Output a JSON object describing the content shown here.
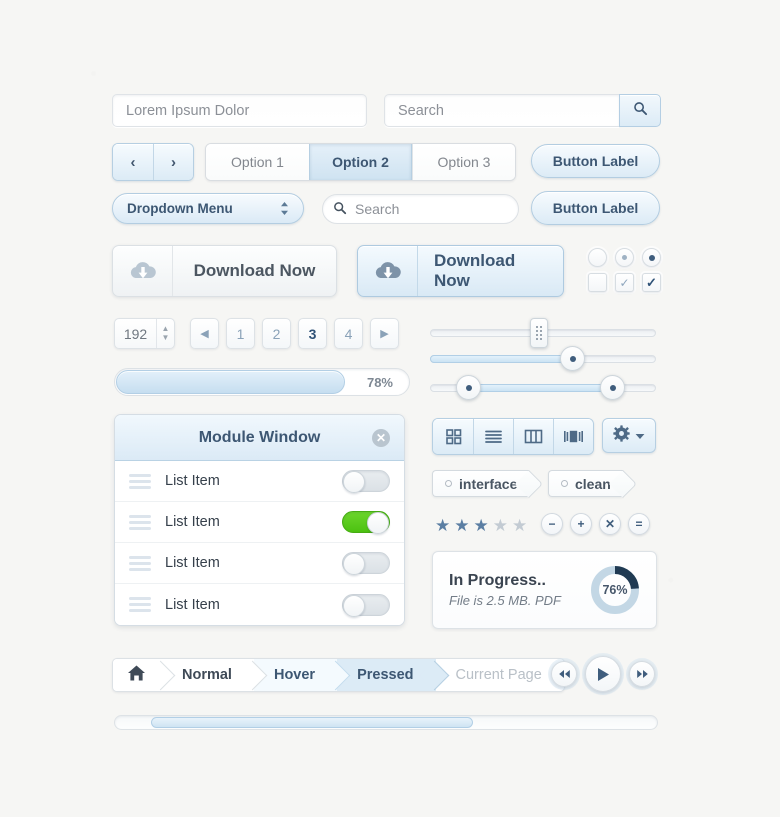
{
  "inputs": {
    "text_field_value": "Lorem Ipsum Dolor",
    "search_field_value": "Search",
    "search_button_icon": "search-icon"
  },
  "nav_arrows": {
    "prev": "‹",
    "next": "›"
  },
  "segmented": {
    "options": [
      {
        "label": "Option 1",
        "active": false
      },
      {
        "label": "Option 2",
        "active": true
      },
      {
        "label": "Option 3",
        "active": false
      }
    ]
  },
  "buttons": {
    "label_1": "Button Label",
    "label_2": "Button Label"
  },
  "dropdown": {
    "label": "Dropdown Menu",
    "icon": "updown-chevron-icon"
  },
  "search_pill": {
    "value": "Search",
    "icon": "search-icon"
  },
  "download": {
    "grey_label": "Download Now",
    "blue_label": "Download Now",
    "icon": "cloud-download-icon"
  },
  "radio_checkbox": {
    "radios": [
      "empty",
      "light-dot",
      "dark-dot"
    ],
    "checkboxes": [
      "empty",
      "light-check",
      "dark-check"
    ]
  },
  "stepper": {
    "value": "192"
  },
  "pagination": {
    "prev_icon": "◀",
    "next_icon": "▶",
    "pages": [
      "1",
      "2",
      "3",
      "4"
    ],
    "current": "3"
  },
  "progress_bar": {
    "percent_label": "78%",
    "value": 78
  },
  "sliders": [
    {
      "name": "plain-slider",
      "fill": 0,
      "handle": "square-grip",
      "position": 48
    },
    {
      "name": "single-handle-slider",
      "fill": 68,
      "handle": "round-dot",
      "position": 68
    },
    {
      "name": "range-slider",
      "from": 13,
      "to": 76
    }
  ],
  "module_window": {
    "title": "Module Window",
    "close_icon": "close-circle-icon",
    "items": [
      {
        "label": "List Item",
        "toggle_on": false
      },
      {
        "label": "List Item",
        "toggle_on": true
      },
      {
        "label": "List Item",
        "toggle_on": false
      },
      {
        "label": "List Item",
        "toggle_on": false
      }
    ]
  },
  "view_modes": {
    "icons": [
      "grid-view-icon",
      "list-view-icon",
      "column-view-icon",
      "coverflow-view-icon"
    ],
    "gear": {
      "icon": "gear-icon",
      "caret": "caret-down-icon"
    }
  },
  "tags": [
    {
      "label": "interface"
    },
    {
      "label": "clean"
    }
  ],
  "rating": {
    "filled": 3,
    "total": 5,
    "star_glyph": "★"
  },
  "circle_actions": [
    {
      "name": "minus-button",
      "glyph": "−"
    },
    {
      "name": "plus-button",
      "glyph": "+"
    },
    {
      "name": "close-button",
      "glyph": "✕"
    },
    {
      "name": "equals-button",
      "glyph": "="
    }
  ],
  "progress_card": {
    "title": "In Progress..",
    "subtitle": "File is 2.5 MB. PDF",
    "percent_label": "76%",
    "value": 76,
    "arc_color": "#203a52",
    "track_color": "#c3d7e5"
  },
  "breadcrumb": {
    "home_icon": "home-icon",
    "items": [
      {
        "label": "Normal",
        "state": "normal"
      },
      {
        "label": "Hover",
        "state": "hover"
      },
      {
        "label": "Pressed",
        "state": "pressed"
      },
      {
        "label": "Current Page",
        "state": "current"
      }
    ]
  },
  "media_controls": [
    {
      "name": "rewind-button",
      "glyph": "◀◀"
    },
    {
      "name": "play-button",
      "glyph": "▶"
    },
    {
      "name": "forward-button",
      "glyph": "▶▶"
    }
  ],
  "scrollbar": {
    "thumb_start": 36,
    "thumb_width": 322
  },
  "colors": {
    "page_bg": "#f6f6f4",
    "accent_blue": "#3d5773",
    "blue_fill": "#dcebf6",
    "blue_border": "#b3cde1",
    "toggle_on_green": "#55c61a",
    "muted_text": "#8e9096"
  }
}
